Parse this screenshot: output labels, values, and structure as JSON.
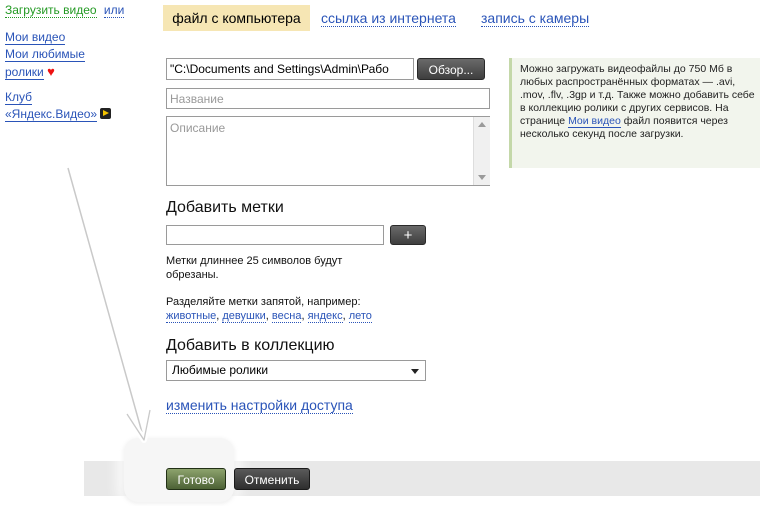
{
  "sidebar": {
    "upload_label": "Загрузить видео",
    "or_label": "или",
    "my_videos": "Мои видео",
    "favorites_line1": "Мои любимые",
    "favorites_line2": "ролики",
    "club_line1": "Клуб",
    "club_line2": "«Яндекс.Видео»"
  },
  "tabs": [
    {
      "label": "файл с компьютера",
      "active": true
    },
    {
      "label": "ссылка из интернета",
      "active": false
    },
    {
      "label": "запись с камеры",
      "active": false
    }
  ],
  "form": {
    "file_path": "\"C:\\Documents and Settings\\Admin\\Рабо",
    "browse_label": "Обзор...",
    "title_placeholder": "Название",
    "description_placeholder": "Описание",
    "tags_title": "Добавить метки",
    "add_tag_label": "+",
    "tags_note": "Метки длиннее 25 символов будут обрезаны.",
    "tags_hint": "Разделяйте метки запятой, например:",
    "tag_examples": [
      "животные",
      "девушки",
      "весна",
      "яндекс",
      "лето"
    ],
    "collection_title": "Добавить в коллекцию",
    "collection_selected": "Любимые ролики",
    "access_link": "изменить настройки доступа"
  },
  "info": {
    "text_before": "Можно загружать видеофайлы до 750 Мб в любых распространённых форматах — .avi, .mov, .flv, .3gp и т.д. Также можно добавить себе в коллекцию ролики с других сервисов. На странице",
    "link": "Мои видео",
    "text_after": "файл появится через несколько секунд после загрузки."
  },
  "actions": {
    "done_label": "Готово",
    "cancel_label": "Отменить"
  },
  "colors": {
    "active_tab": "#f6e6b4",
    "link": "#2a54b8",
    "upload_link": "#229922",
    "info_bg": "#f2f5ed",
    "done_button": "#5f7745"
  }
}
